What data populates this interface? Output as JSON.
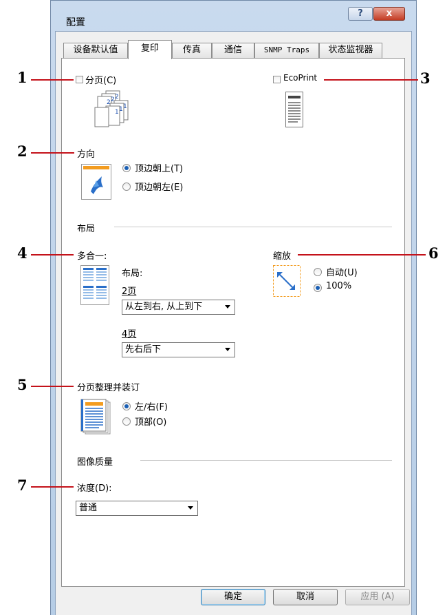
{
  "window": {
    "title": "配置",
    "help_glyph": "?",
    "close_glyph": "x"
  },
  "tabs": [
    {
      "label": "设备默认值"
    },
    {
      "label": "复印"
    },
    {
      "label": "传真"
    },
    {
      "label": "通信"
    },
    {
      "label": "SNMP Traps"
    },
    {
      "label": "状态监视器"
    }
  ],
  "copies": {
    "collate_label": "分页(C)",
    "collate_checked": false,
    "ecoprint_label": "EcoPrint",
    "ecoprint_checked": false,
    "collate_numbers": [
      "2",
      "2",
      "2",
      "1",
      "1",
      "1"
    ]
  },
  "orientation": {
    "title": "方向",
    "options": [
      {
        "label": "顶边朝上(T)",
        "selected": true
      },
      {
        "label": "顶边朝左(E)",
        "selected": false
      }
    ]
  },
  "layout": {
    "title": "布局",
    "multi_up_title": "多合一:",
    "layout_label": "布局:",
    "two_page_label": "2页",
    "two_page_value": "从左到右, 从上到下",
    "four_page_label": "4页",
    "four_page_value": "先右后下",
    "scaling_title": "缩放",
    "scaling_options": [
      {
        "label": "自动(U)",
        "selected": false
      },
      {
        "label": "100%",
        "selected": true
      }
    ]
  },
  "binding": {
    "title": "分页整理并装订",
    "options": [
      {
        "label": "左/右(F)",
        "selected": true
      },
      {
        "label": "顶部(O)",
        "selected": false
      }
    ]
  },
  "image_quality": {
    "title": "图像质量",
    "density_label": "浓度(D):",
    "density_value": "普通"
  },
  "buttons": {
    "ok": "确定",
    "cancel": "取消",
    "apply": "应用 (A)"
  },
  "callouts": [
    "1",
    "2",
    "3",
    "4",
    "5",
    "6",
    "7"
  ],
  "colors": {
    "callout_line": "#c4121a",
    "icon_orange": "#f39c1f",
    "icon_blue": "#2a6fc9",
    "radio_selected": "#1a5fb4"
  }
}
